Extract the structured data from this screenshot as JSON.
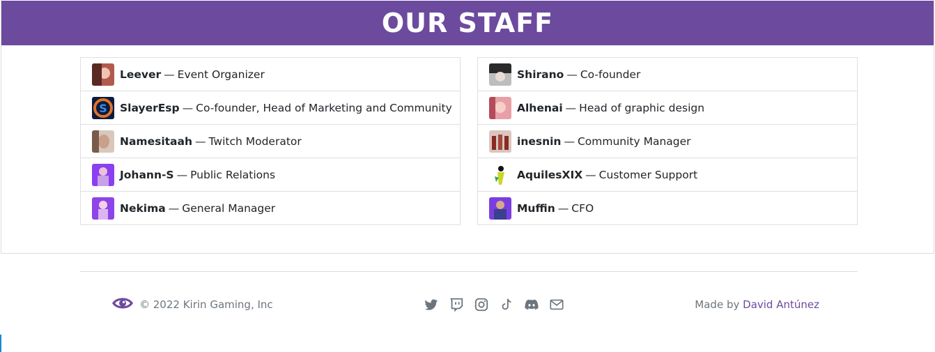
{
  "header": {
    "title": "OUR STAFF"
  },
  "staff": {
    "left": [
      {
        "name": "Leever",
        "sep": "—",
        "role": "Event Organizer",
        "avatar_color": "#b35a4e"
      },
      {
        "name": "SlayerEsp",
        "sep": "—",
        "role": "Co-founder, Head of Marketing and Community",
        "avatar_color": "#1c3f8a"
      },
      {
        "name": "Namesitaah",
        "sep": "—",
        "role": "Twitch Moderator",
        "avatar_color": "#b69a88"
      },
      {
        "name": "Johann-S",
        "sep": "—",
        "role": "Public Relations",
        "avatar_color": "#7b3fe4"
      },
      {
        "name": "Nekima",
        "sep": "—",
        "role": "General Manager",
        "avatar_color": "#8e44e8"
      }
    ],
    "right": [
      {
        "name": "Shirano",
        "sep": "—",
        "role": "Co-founder",
        "avatar_color": "#4a4a4a"
      },
      {
        "name": "Alhenai",
        "sep": "—",
        "role": "Head of graphic design",
        "avatar_color": "#c7737a"
      },
      {
        "name": "inesnin",
        "sep": "—",
        "role": "Community Manager",
        "avatar_color": "#a0493c"
      },
      {
        "name": "AquilesXIX",
        "sep": "—",
        "role": "Customer Support",
        "avatar_color": "#d8e23a"
      },
      {
        "name": "Muffin",
        "sep": "—",
        "role": "CFO",
        "avatar_color": "#7a3ee0"
      }
    ]
  },
  "footer": {
    "copyright": "© 2022 Kirin Gaming, Inc",
    "made_by_prefix": "Made by",
    "made_by_name": "David Antúnez",
    "socials": [
      "twitter-icon",
      "twitch-icon",
      "instagram-icon",
      "tiktok-icon",
      "discord-icon",
      "mail-icon"
    ]
  },
  "colors": {
    "brand": "#6c4a9e",
    "muted": "#6c757d"
  }
}
